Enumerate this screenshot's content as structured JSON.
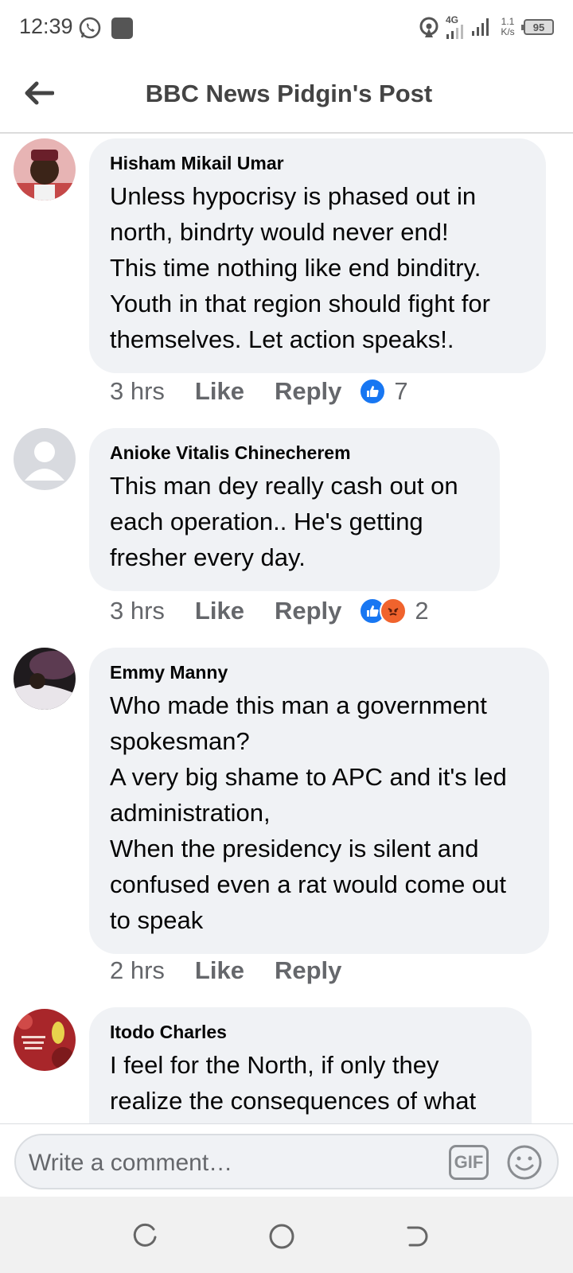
{
  "status_bar": {
    "time": "12:39",
    "network": "4G",
    "speed": "1.1 K/s",
    "battery": "95"
  },
  "header": {
    "title": "BBC News Pidgin's Post"
  },
  "comments": [
    {
      "author": "Hisham Mikail Umar",
      "text": "Unless hypocrisy is phased out  in north, bindrty would never end!\nThis time nothing like end binditry. Youth in that region should fight for themselves. Let action speaks!.",
      "time": "3 hrs",
      "like_label": "Like",
      "reply_label": "Reply",
      "reaction_count": "7",
      "reactions": [
        "like"
      ]
    },
    {
      "author": "Anioke Vitalis Chinecherem",
      "text": "This man dey really cash out on each operation.. He's getting fresher every day.",
      "time": "3 hrs",
      "like_label": "Like",
      "reply_label": "Reply",
      "reaction_count": "2",
      "reactions": [
        "like",
        "angry"
      ]
    },
    {
      "author": "Emmy Manny",
      "text": "Who made this man a government spokesman?\nA very big shame to APC and it's led administration,\nWhen the presidency is silent and confused even a rat would come out to speak",
      "time": "2 hrs",
      "like_label": "Like",
      "reply_label": "Reply"
    },
    {
      "author": "Itodo Charles",
      "text": "I feel for the North, if only they realize the consequences of what"
    }
  ],
  "composer": {
    "placeholder": "Write a comment…",
    "gif_label": "GIF"
  },
  "icons": {
    "back": "arrow-left-icon",
    "gif": "gif-icon",
    "emoji": "smiley-icon",
    "like_reaction": "thumbs-up-icon",
    "angry_reaction": "angry-face-icon"
  },
  "colors": {
    "bubble": "#f0f2f5",
    "like_blue": "#1877f2",
    "angry_orange": "#f0632d",
    "secondary_text": "#65676b"
  }
}
